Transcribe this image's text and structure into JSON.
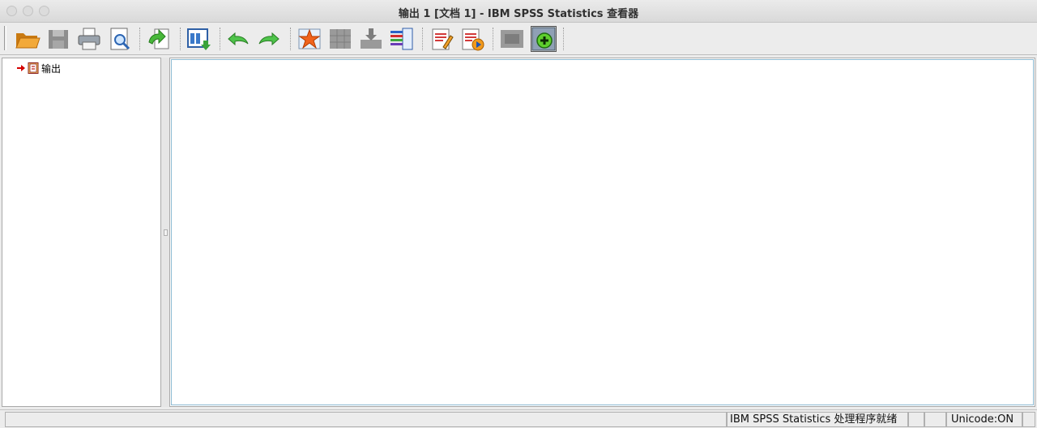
{
  "window": {
    "title": "输出 1 [文档 1] - IBM SPSS Statistics 查看器"
  },
  "toolbar": {
    "buttons": [
      {
        "icon": "open-folder-icon"
      },
      {
        "icon": "save-icon"
      },
      {
        "icon": "print-icon"
      },
      {
        "icon": "print-preview-icon"
      },
      {
        "icon": "export-icon"
      },
      {
        "icon": "recall-dialog-icon"
      },
      {
        "icon": "undo-icon"
      },
      {
        "icon": "redo-icon"
      },
      {
        "icon": "goto-case-icon"
      },
      {
        "icon": "goto-variable-icon"
      },
      {
        "icon": "insert-case-icon"
      },
      {
        "icon": "variables-icon"
      },
      {
        "icon": "new-title-icon"
      },
      {
        "icon": "new-text-icon"
      },
      {
        "icon": "show-hide-icon"
      },
      {
        "icon": "designate-window-icon"
      }
    ]
  },
  "outline": {
    "root_label": "输出"
  },
  "status": {
    "processor": "IBM SPSS Statistics 处理程序就绪",
    "unicode": "Unicode:ON"
  },
  "colors": {
    "content_border": "#8fbcd4",
    "arrow": "#d40000"
  }
}
